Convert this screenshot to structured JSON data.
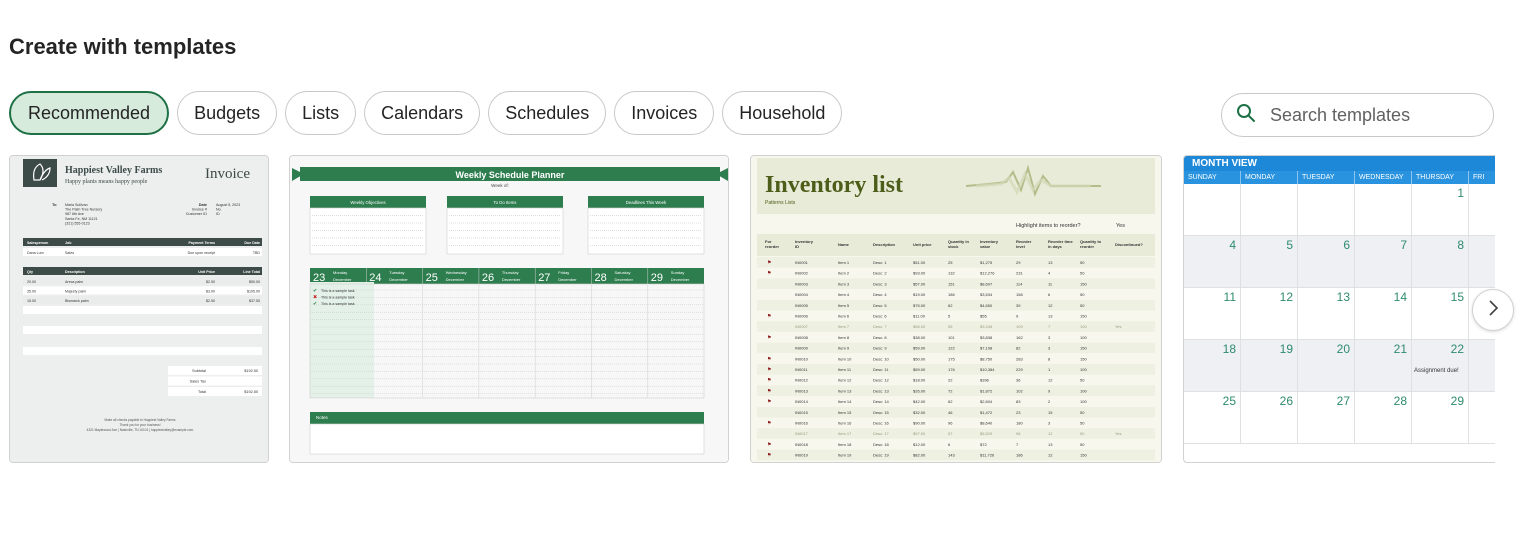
{
  "page": {
    "title": "Create with templates"
  },
  "tabs": [
    {
      "label": "Recommended",
      "active": true
    },
    {
      "label": "Budgets"
    },
    {
      "label": "Lists"
    },
    {
      "label": "Calendars"
    },
    {
      "label": "Schedules"
    },
    {
      "label": "Invoices"
    },
    {
      "label": "Household"
    }
  ],
  "search": {
    "placeholder": "Search templates",
    "icon": "search-icon"
  },
  "colors": {
    "accent": "#1e7145",
    "accent_bg": "#d7ebdd",
    "calendar_blue": "#1e88d8",
    "invoice_dark": "#3c4a48",
    "planner_green": "#2e7d4f",
    "inventory_olive": "#4d5d1a"
  },
  "templates": {
    "invoice": {
      "company": "Happiest Valley Farms",
      "tagline": "Happy plants means happy people",
      "doc_title": "Invoice",
      "to_label": "To",
      "to_lines": [
        "Maria Sullivan",
        "The Palm Tree Nursery",
        "987 6th Ave",
        "Santa Fe, NM 11121",
        "(321) 555-0123"
      ],
      "meta": [
        {
          "label": "Date",
          "value": "August 5, 2023"
        },
        {
          "label": "Invoice #",
          "value": "No."
        },
        {
          "label": "Customer ID",
          "value": "ID"
        }
      ],
      "table1_headers": [
        "Salesperson",
        "Job",
        "Payment Terms",
        "Due Date"
      ],
      "table1_row": [
        "Dana Lum",
        "Sales",
        "Due upon receipt",
        "TBD"
      ],
      "table2_headers": [
        "Qty",
        "Description",
        "Unit Price",
        "Line Total"
      ],
      "table2_rows": [
        [
          "20.00",
          "Areca palm",
          "$2.50",
          "$50.00"
        ],
        [
          "35.00",
          "Majesty palm",
          "$3.00",
          "$105.00"
        ],
        [
          "15.00",
          "Bismarck palm",
          "$2.50",
          "$37.50"
        ]
      ],
      "totals": [
        {
          "label": "Subtotal",
          "value": "$192.50"
        },
        {
          "label": "Sales Tax",
          "value": ""
        },
        {
          "label": "Total",
          "value": "$192.50"
        }
      ],
      "footer_lines": [
        "Make all checks payable to Happiest Valley Farms",
        "Thank you for your business!",
        "4321 Maplewood Ave | Nashville, TN 10101 | happiestvalley@example.com"
      ]
    },
    "planner": {
      "title": "Weekly Schedule Planner",
      "week_of": "Week of:",
      "boxes": [
        "Weekly Objectives",
        "To Do Items",
        "Deadlines This Week"
      ],
      "days": [
        {
          "num": "23",
          "day": "Monday",
          "month": "December"
        },
        {
          "num": "24",
          "day": "Tuesday",
          "month": "December"
        },
        {
          "num": "25",
          "day": "Wednesday",
          "month": "December"
        },
        {
          "num": "26",
          "day": "Thursday",
          "month": "December"
        },
        {
          "num": "27",
          "day": "Friday",
          "month": "December"
        },
        {
          "num": "28",
          "day": "Saturday",
          "month": "December"
        },
        {
          "num": "29",
          "day": "Sunday",
          "month": "December"
        }
      ],
      "tasks": [
        "This is a sample task",
        "This is a sample task",
        "This is a sample task"
      ],
      "notes_label": "Notes"
    },
    "inventory": {
      "title": "Inventory list",
      "subtitle": "Patterns Lists",
      "highlight_label": "Highlight items to reorder?",
      "highlight_value": "Yes",
      "headers": [
        "For reorder",
        "Inventory ID",
        "Name",
        "Description",
        "Unit price",
        "Quantity in stock",
        "Inventory value",
        "Reorder level",
        "Reorder time in days",
        "Quantity to reorder",
        "Discontinued?"
      ],
      "rows": [
        [
          "flag",
          "IN0001",
          "Item 1",
          "Desc: 1",
          "$51.00",
          "25",
          "$1,275",
          "29",
          "13",
          "50",
          ""
        ],
        [
          "flag",
          "IN0002",
          "Item 2",
          "Desc: 2",
          "$93.00",
          "132",
          "$12,276",
          "231",
          "4",
          "50",
          ""
        ],
        [
          "",
          "IN0003",
          "Item 3",
          "Desc: 3",
          "$57.00",
          "151",
          "$8,607",
          "114",
          "11",
          "150",
          ""
        ],
        [
          "",
          "IN0004",
          "Item 4",
          "Desc: 4",
          "$19.00",
          "186",
          "$3,534",
          "158",
          "6",
          "50",
          ""
        ],
        [
          "",
          "IN0005",
          "Item 5",
          "Desc: 5",
          "$75.00",
          "62",
          "$4,650",
          "39",
          "12",
          "50",
          ""
        ],
        [
          "flag",
          "IN0006",
          "Item 6",
          "Desc: 6",
          "$11.00",
          "5",
          "$55",
          "9",
          "13",
          "150",
          ""
        ],
        [
          "",
          "IN0007",
          "Item 7",
          "Desc: 7",
          "$56.00",
          "58",
          "$3,248",
          "109",
          "7",
          "100",
          "Yes"
        ],
        [
          "flag",
          "IN0008",
          "Item 8",
          "Desc: 8",
          "$38.00",
          "101",
          "$3,838",
          "162",
          "3",
          "100",
          ""
        ],
        [
          "",
          "IN0009",
          "Item 9",
          "Desc: 9",
          "$59.00",
          "122",
          "$7,198",
          "82",
          "3",
          "150",
          ""
        ],
        [
          "flag",
          "IN0010",
          "Item 10",
          "Desc: 10",
          "$50.00",
          "175",
          "$8,750",
          "283",
          "8",
          "150",
          ""
        ],
        [
          "flag",
          "IN0011",
          "Item 11",
          "Desc: 11",
          "$59.00",
          "176",
          "$10,384",
          "229",
          "1",
          "100",
          ""
        ],
        [
          "flag",
          "IN0012",
          "Item 12",
          "Desc: 12",
          "$18.00",
          "22",
          "$396",
          "36",
          "12",
          "50",
          ""
        ],
        [
          "flag",
          "IN0013",
          "Item 13",
          "Desc: 13",
          "$26.00",
          "72",
          "$1,872",
          "102",
          "9",
          "100",
          ""
        ],
        [
          "flag",
          "IN0014",
          "Item 14",
          "Desc: 14",
          "$42.00",
          "62",
          "$2,604",
          "83",
          "2",
          "100",
          ""
        ],
        [
          "",
          "IN0015",
          "Item 15",
          "Desc: 15",
          "$32.00",
          "46",
          "$1,472",
          "23",
          "15",
          "50",
          ""
        ],
        [
          "flag",
          "IN0016",
          "Item 16",
          "Desc: 16",
          "$90.00",
          "96",
          "$8,640",
          "180",
          "3",
          "50",
          ""
        ],
        [
          "",
          "IN0017",
          "Item 17",
          "Desc: 17",
          "$97.00",
          "57",
          "$5,529",
          "98",
          "12",
          "50",
          "Yes"
        ],
        [
          "flag",
          "IN0018",
          "Item 18",
          "Desc: 18",
          "$12.00",
          "6",
          "$72",
          "7",
          "13",
          "50",
          ""
        ],
        [
          "flag",
          "IN0019",
          "Item 19",
          "Desc: 19",
          "$82.00",
          "143",
          "$11,726",
          "186",
          "12",
          "150",
          ""
        ]
      ]
    },
    "calendar": {
      "header": "MONTH VIEW",
      "days": [
        "SUNDAY",
        "MONDAY",
        "TUESDAY",
        "WEDNESDAY",
        "THURSDAY",
        "FRI"
      ],
      "weeks": [
        [
          "",
          "",
          "",
          "",
          "1"
        ],
        [
          "4",
          "5",
          "6",
          "7",
          "8"
        ],
        [
          "11",
          "12",
          "13",
          "14",
          "15"
        ],
        [
          "18",
          "19",
          "20",
          "21",
          "22"
        ],
        [
          "25",
          "26",
          "27",
          "28",
          "29"
        ]
      ],
      "note": "Assignment due!"
    }
  },
  "carousel": {
    "next_icon": "chevron-right-icon"
  }
}
